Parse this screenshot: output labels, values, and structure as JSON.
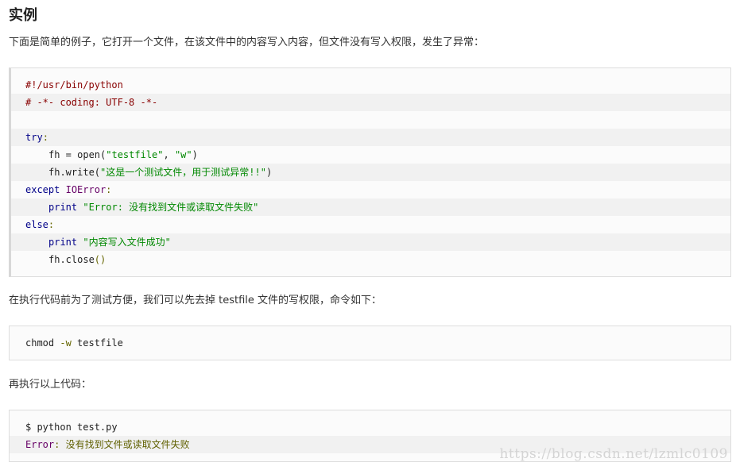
{
  "heading": "实例",
  "intro": "下面是简单的例子，它打开一个文件，在该文件中的内容写入内容，但文件没有写入权限，发生了异常：",
  "code1": {
    "shebang": "#!/usr/bin/python",
    "coding": "# -*- coding: UTF-8 -*-",
    "try_kw": "try",
    "colon": ":",
    "fh_assign": "fh = open(",
    "arg1": "\"testfile\"",
    "comma": ", ",
    "arg2": "\"w\"",
    "close_paren": ")",
    "write_call": "fh.write(",
    "write_str": "\"这是一个测试文件，用于测试异常!!\"",
    "except_kw": "except",
    "ioerror": "IOError",
    "print_kw": "print",
    "error_str": "\"Error: 没有找到文件或读取文件失败\"",
    "else_kw": "else",
    "success_str": "\"内容写入文件成功\"",
    "close_call": "fh.close",
    "close_parens": "()"
  },
  "para2": "在执行代码前为了测试方便，我们可以先去掉 testfile 文件的写权限，命令如下：",
  "code2": {
    "cmd": "chmod",
    "flag": "-w",
    "target": "testfile"
  },
  "para3": "再执行以上代码：",
  "code3": {
    "prompt_line": "$ python test.py",
    "error_label": "Error",
    "error_colon": ":",
    "error_msg": " 没有找到文件或读取文件失败"
  },
  "watermark": "https://blog.csdn.net/lzmlc0109"
}
